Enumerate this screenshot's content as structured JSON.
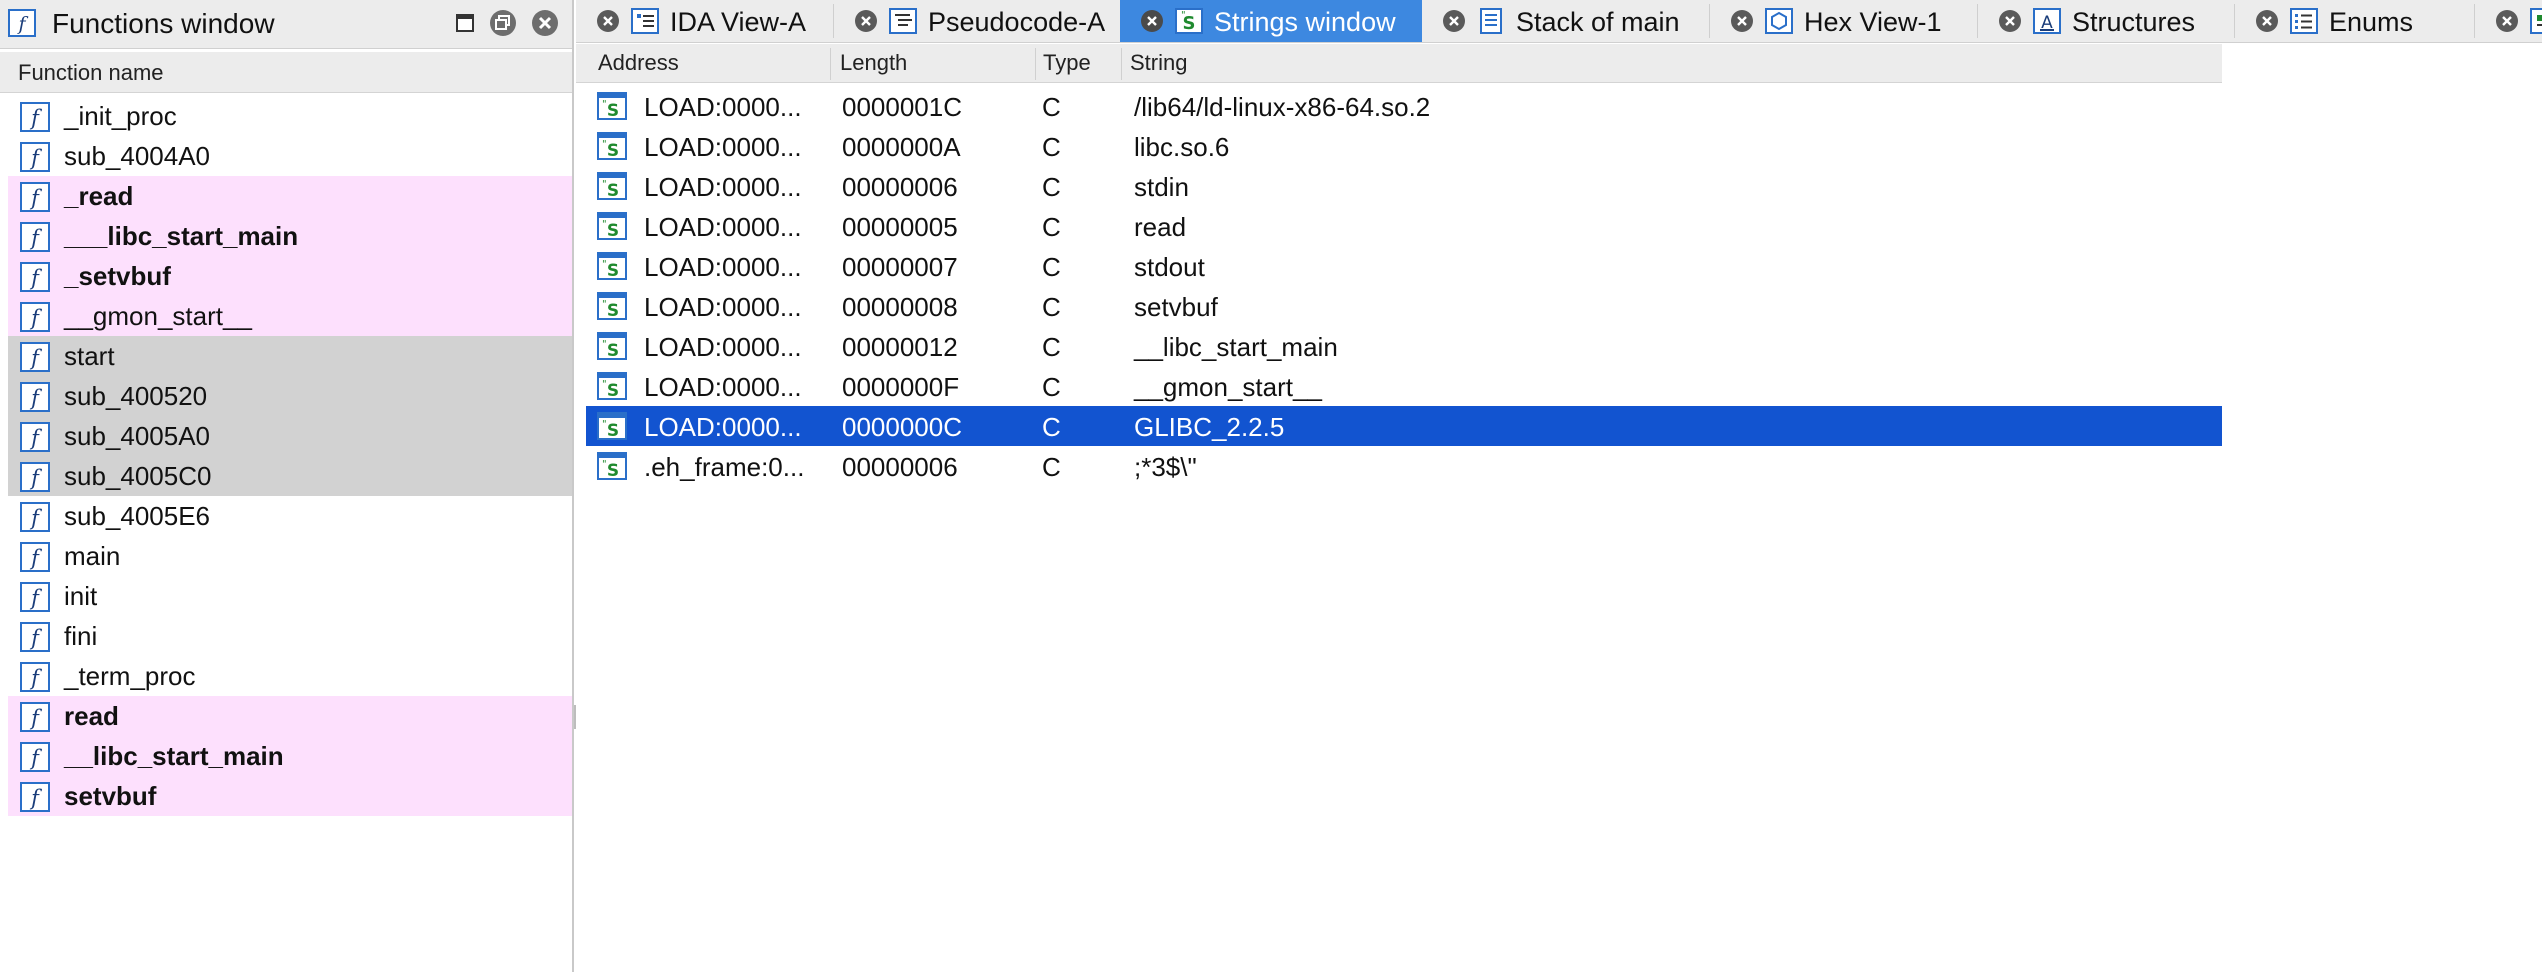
{
  "functions_window": {
    "title": "Functions window",
    "column_header": "Function name",
    "items": [
      {
        "name": "_init_proc",
        "style": "normal"
      },
      {
        "name": "sub_4004A0",
        "style": "normal"
      },
      {
        "name": "_read",
        "style": "import"
      },
      {
        "name": "___libc_start_main",
        "style": "import"
      },
      {
        "name": "_setvbuf",
        "style": "import"
      },
      {
        "name": "__gmon_start__",
        "style": "import-light"
      },
      {
        "name": "start",
        "style": "library"
      },
      {
        "name": "sub_400520",
        "style": "library"
      },
      {
        "name": "sub_4005A0",
        "style": "library"
      },
      {
        "name": "sub_4005C0",
        "style": "library"
      },
      {
        "name": "sub_4005E6",
        "style": "normal"
      },
      {
        "name": "main",
        "style": "normal"
      },
      {
        "name": "init",
        "style": "normal"
      },
      {
        "name": "fini",
        "style": "normal"
      },
      {
        "name": "_term_proc",
        "style": "normal"
      },
      {
        "name": "read",
        "style": "import"
      },
      {
        "name": "__libc_start_main",
        "style": "import"
      },
      {
        "name": "setvbuf",
        "style": "import"
      }
    ]
  },
  "tabs": [
    {
      "label": "IDA View-A",
      "icon": "ida-view-icon",
      "active": false
    },
    {
      "label": "Pseudocode-A",
      "icon": "pseudocode-icon",
      "active": false
    },
    {
      "label": "Strings window",
      "icon": "strings-icon",
      "active": true
    },
    {
      "label": "Stack of main",
      "icon": "stack-icon",
      "active": false
    },
    {
      "label": "Hex View-1",
      "icon": "hex-view-icon",
      "active": false
    },
    {
      "label": "Structures",
      "icon": "structures-icon",
      "active": false
    },
    {
      "label": "Enums",
      "icon": "enums-icon",
      "active": false
    }
  ],
  "strings_window": {
    "columns": [
      "Address",
      "Length",
      "Type",
      "String"
    ],
    "rows": [
      {
        "address": "LOAD:0000...",
        "length": "0000001C",
        "type": "C",
        "string": "/lib64/ld-linux-x86-64.so.2",
        "selected": false
      },
      {
        "address": "LOAD:0000...",
        "length": "0000000A",
        "type": "C",
        "string": "libc.so.6",
        "selected": false
      },
      {
        "address": "LOAD:0000...",
        "length": "00000006",
        "type": "C",
        "string": "stdin",
        "selected": false
      },
      {
        "address": "LOAD:0000...",
        "length": "00000005",
        "type": "C",
        "string": "read",
        "selected": false
      },
      {
        "address": "LOAD:0000...",
        "length": "00000007",
        "type": "C",
        "string": "stdout",
        "selected": false
      },
      {
        "address": "LOAD:0000...",
        "length": "00000008",
        "type": "C",
        "string": "setvbuf",
        "selected": false
      },
      {
        "address": "LOAD:0000...",
        "length": "00000012",
        "type": "C",
        "string": "__libc_start_main",
        "selected": false
      },
      {
        "address": "LOAD:0000...",
        "length": "0000000F",
        "type": "C",
        "string": "__gmon_start__",
        "selected": false
      },
      {
        "address": "LOAD:0000...",
        "length": "0000000C",
        "type": "C",
        "string": "GLIBC_2.2.5",
        "selected": true
      },
      {
        "address": ".eh_frame:0...",
        "length": "00000006",
        "type": "C",
        "string": ";*3$\\\"",
        "selected": false
      }
    ]
  },
  "colors": {
    "import_row": "#fde0fd",
    "library_row": "#d2d2d2",
    "active_tab": "#3d88e0",
    "selected_row": "#1254d0"
  }
}
